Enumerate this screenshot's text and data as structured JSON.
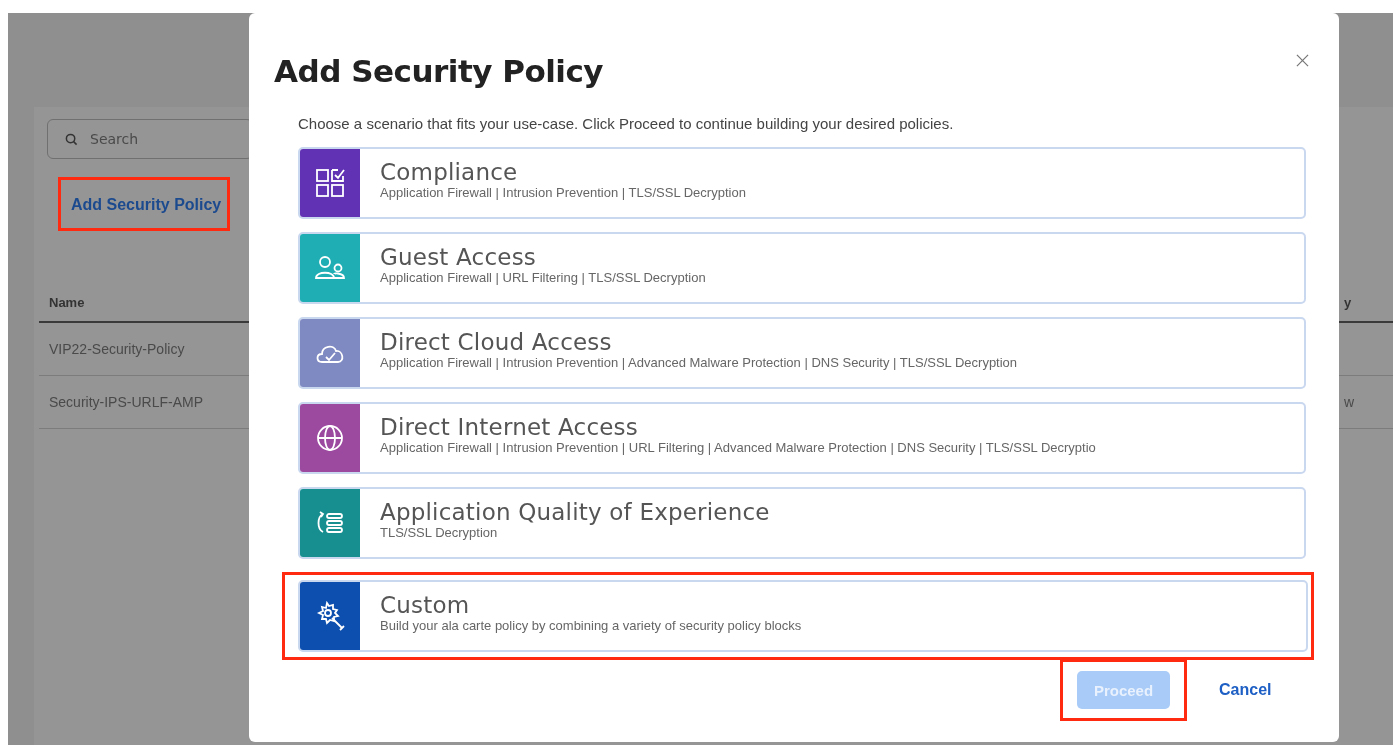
{
  "background": {
    "search": {
      "placeholder": "Search"
    },
    "add_link": {
      "label": "Add Security Policy",
      "highlighted": true
    },
    "table": {
      "columns": [
        "Name",
        "y"
      ],
      "rows": [
        {
          "cells": [
            "VIP22-Security-Policy",
            ""
          ]
        },
        {
          "cells": [
            "Security-IPS-URLF-AMP",
            "w"
          ]
        }
      ]
    }
  },
  "dialog": {
    "title": "Add Security Policy",
    "description": "Choose a scenario that fits your use-case. Click Proceed to continue building your desired policies.",
    "scenarios": [
      {
        "kind": "compliance",
        "title": "Compliance",
        "subtitle": "Application Firewall | Intrusion Prevention | TLS/SSL Decryption",
        "color": "#6133b4",
        "highlighted": false
      },
      {
        "kind": "guest",
        "title": "Guest Access",
        "subtitle": "Application Firewall | URL Filtering | TLS/SSL Decryption",
        "color": "#1eaeb3",
        "highlighted": false
      },
      {
        "kind": "cloud",
        "title": "Direct Cloud Access",
        "subtitle": "Application Firewall | Intrusion Prevention | Advanced Malware Protection | DNS Security | TLS/SSL Decryption",
        "color": "#7f89c2",
        "highlighted": false
      },
      {
        "kind": "internet",
        "title": "Direct Internet Access",
        "subtitle": "Application Firewall | Intrusion Prevention | URL Filtering | Advanced Malware Protection | DNS Security | TLS/SSL Decryptio",
        "color": "#9b4aa0",
        "highlighted": false
      },
      {
        "kind": "quality",
        "title": "Application Quality of Experience",
        "subtitle": "TLS/SSL Decryption",
        "color": "#178f91",
        "highlighted": false
      },
      {
        "kind": "custom",
        "title": "Custom",
        "subtitle": "Build your ala carte policy by combining a variety of security policy blocks",
        "color": "#0d4fae",
        "highlighted": true
      }
    ],
    "proceed": {
      "label": "Proceed",
      "disabled": true,
      "highlighted": true
    },
    "cancel": {
      "label": "Cancel"
    }
  }
}
